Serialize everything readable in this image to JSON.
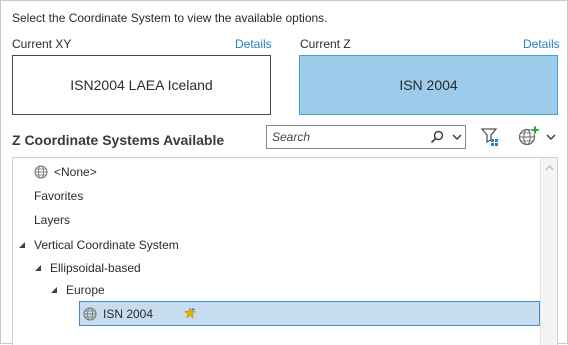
{
  "instruction": "Select the Coordinate System to view the available options.",
  "current_xy": {
    "label": "Current XY",
    "details": "Details",
    "value": "ISN2004 LAEA Iceland"
  },
  "current_z": {
    "label": "Current Z",
    "details": "Details",
    "value": "ISN 2004"
  },
  "section_title": "Z Coordinate Systems Available",
  "search": {
    "placeholder": "Search"
  },
  "tree": {
    "none": "<None>",
    "favorites": "Favorites",
    "layers": "Layers",
    "vertical": "Vertical Coordinate System",
    "ellipsoidal": "Ellipsoidal-based",
    "europe": "Europe",
    "selected": "ISN 2004"
  },
  "colors": {
    "accent_link": "#2a7fc6",
    "selected_fill": "#9dcbea",
    "row_selected": "#c7ddef",
    "star": "#e8b400"
  }
}
